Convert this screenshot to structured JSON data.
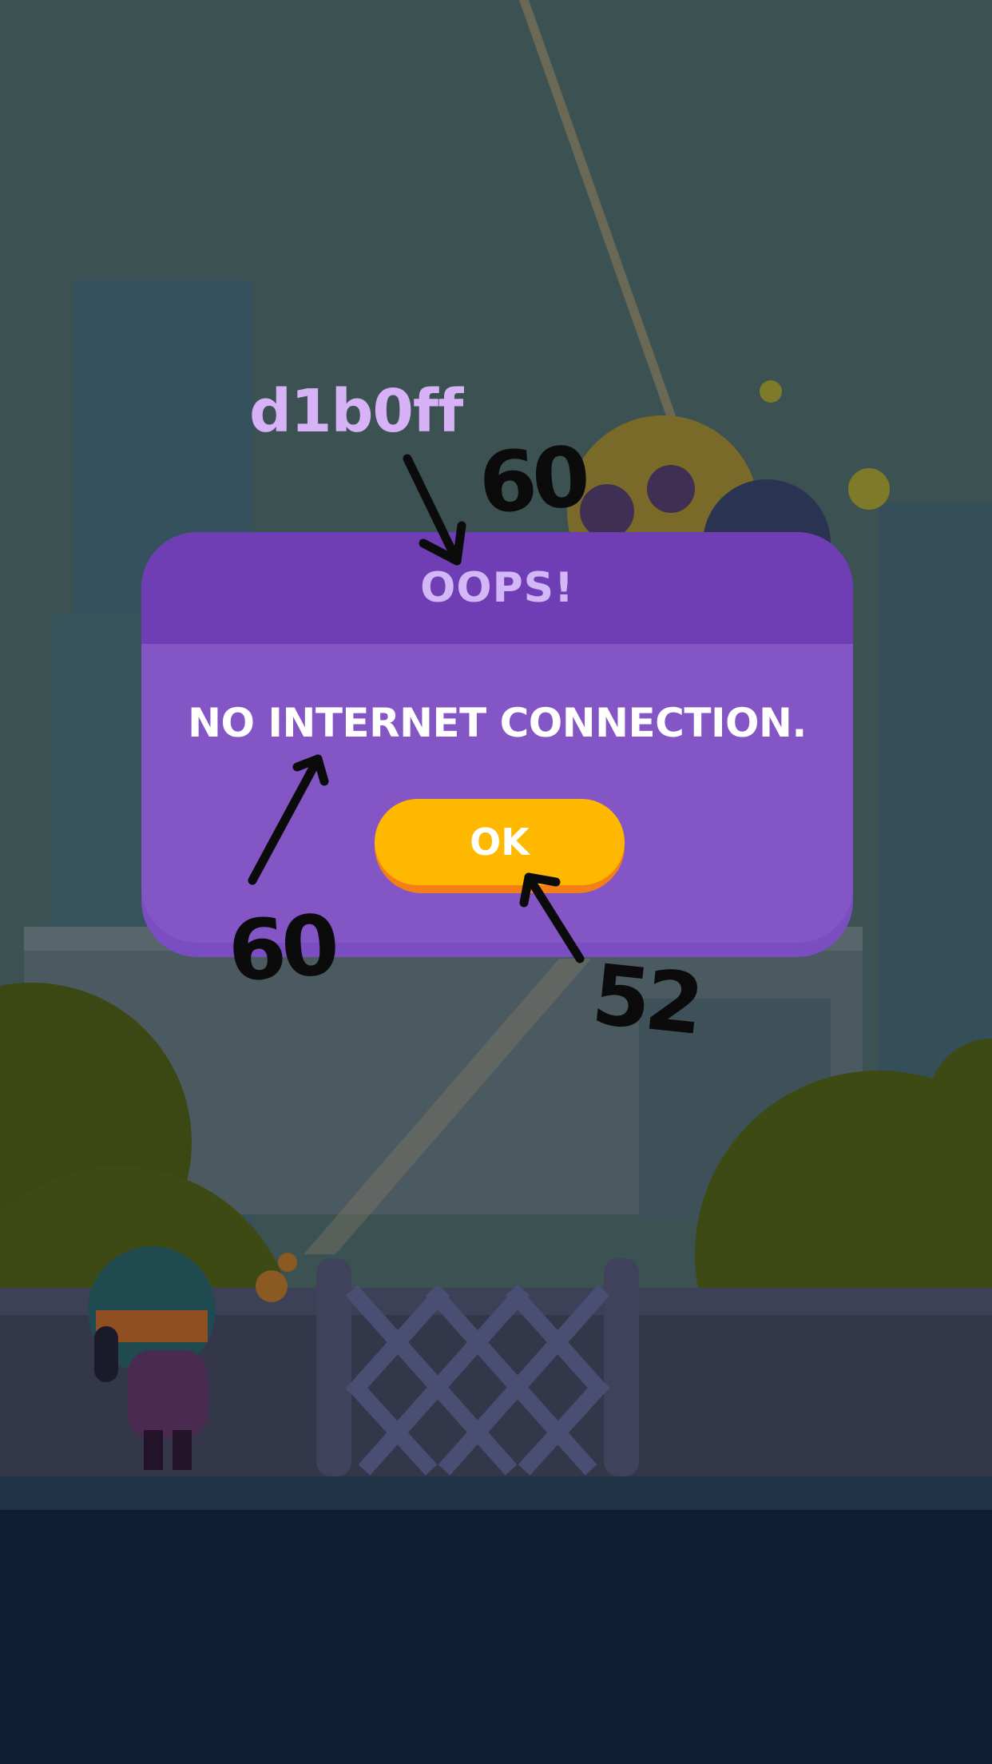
{
  "dialog": {
    "title": "OOPS!",
    "message": "NO INTERNET CONNECTION.",
    "ok_label": "OK"
  },
  "overlay": {
    "debug_tag": "d1b0ff",
    "annotations": [
      "60",
      "60",
      "52"
    ]
  },
  "colors": {
    "dialog_header": "#6f3db4",
    "dialog_body": "#8455c4",
    "button": "#ffb800",
    "button_shadow": "#f57f17",
    "debug_tag": "#d7b2f7"
  }
}
